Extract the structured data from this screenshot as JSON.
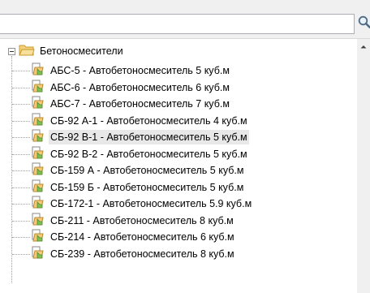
{
  "search": {
    "value": "",
    "placeholder": ""
  },
  "tree": {
    "root": {
      "label": "Бетоносмесители",
      "children": [
        "АБС-5 - Автобетоносмеситель 5 куб.м",
        "АБС-6 - Автобетоносмеситель 6 куб.м",
        "АБС-7 - Автобетоносмеситель 7 куб.м",
        "СБ-92 А-1 - Автобетоносмеситель 4 куб.м",
        "СБ-92 В-1 - Автобетоносмеситель 5 куб.м",
        "СБ-92 В-2 - Автобетоносмеситель 5 куб.м",
        "СБ-159 А - Автобетоносмеситель 5 куб.м",
        "СБ-159 Б - Автобетоносмеситель 5 куб.м",
        "СБ-172-1 - Автобетоносмеситель 5.9 куб.м",
        "СБ-211 - Автобетоносмеситель 8 куб.м",
        "СБ-214 - Автобетоносмеситель 6 куб.м",
        "СБ-239 - Автобетоносмеситель 8 куб.м"
      ],
      "selected_index": 4
    }
  },
  "icons": {
    "search": "magnifier-icon",
    "root": "folder-open-icon",
    "item": "document-icon",
    "expander": "minus-expander-icon",
    "scroll_up": "arrow-up-icon"
  },
  "colors": {
    "folder": "#e8b84a",
    "document_green": "#6fb04a",
    "selection": "#e8e8e8"
  }
}
